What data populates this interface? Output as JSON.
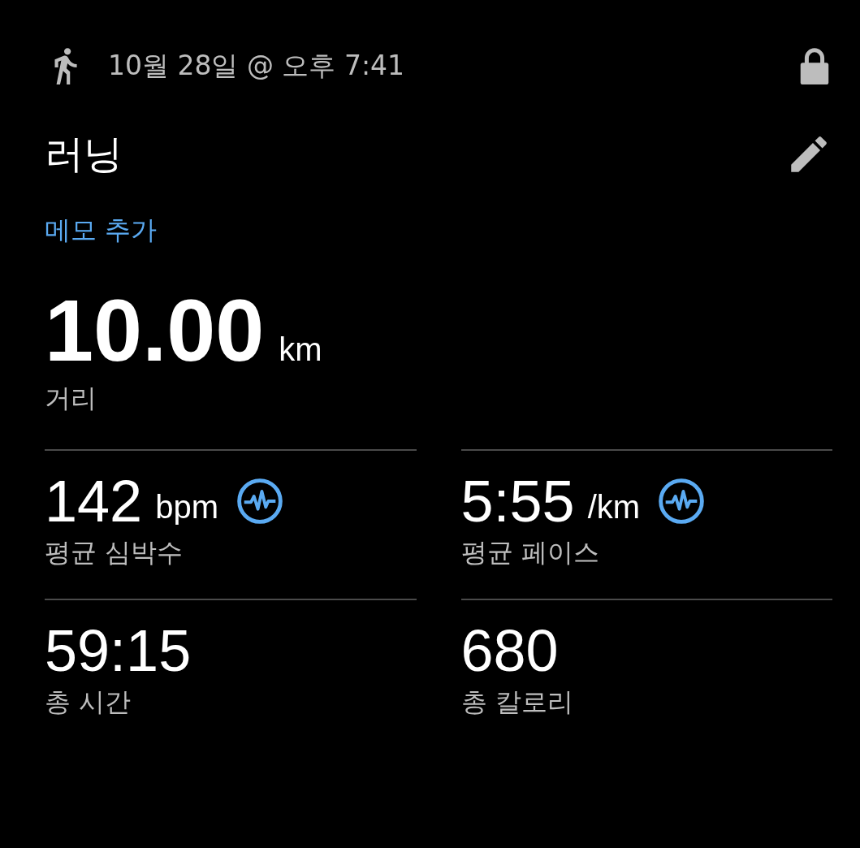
{
  "header": {
    "date": "10월 28일 @ 오후 7:41"
  },
  "title": "러닝",
  "memo_link": "메모 추가",
  "distance": {
    "value": "10.00",
    "unit": "km",
    "label": "거리"
  },
  "stats": [
    {
      "value": "142",
      "unit": "bpm",
      "label": "평균 심박수",
      "has_chart": true
    },
    {
      "value": "5:55",
      "unit": "/km",
      "label": "평균 페이스",
      "has_chart": true
    },
    {
      "value": "59:15",
      "label": "총 시간",
      "has_chart": false
    },
    {
      "value": "680",
      "label": "총 칼로리",
      "has_chart": false
    }
  ]
}
